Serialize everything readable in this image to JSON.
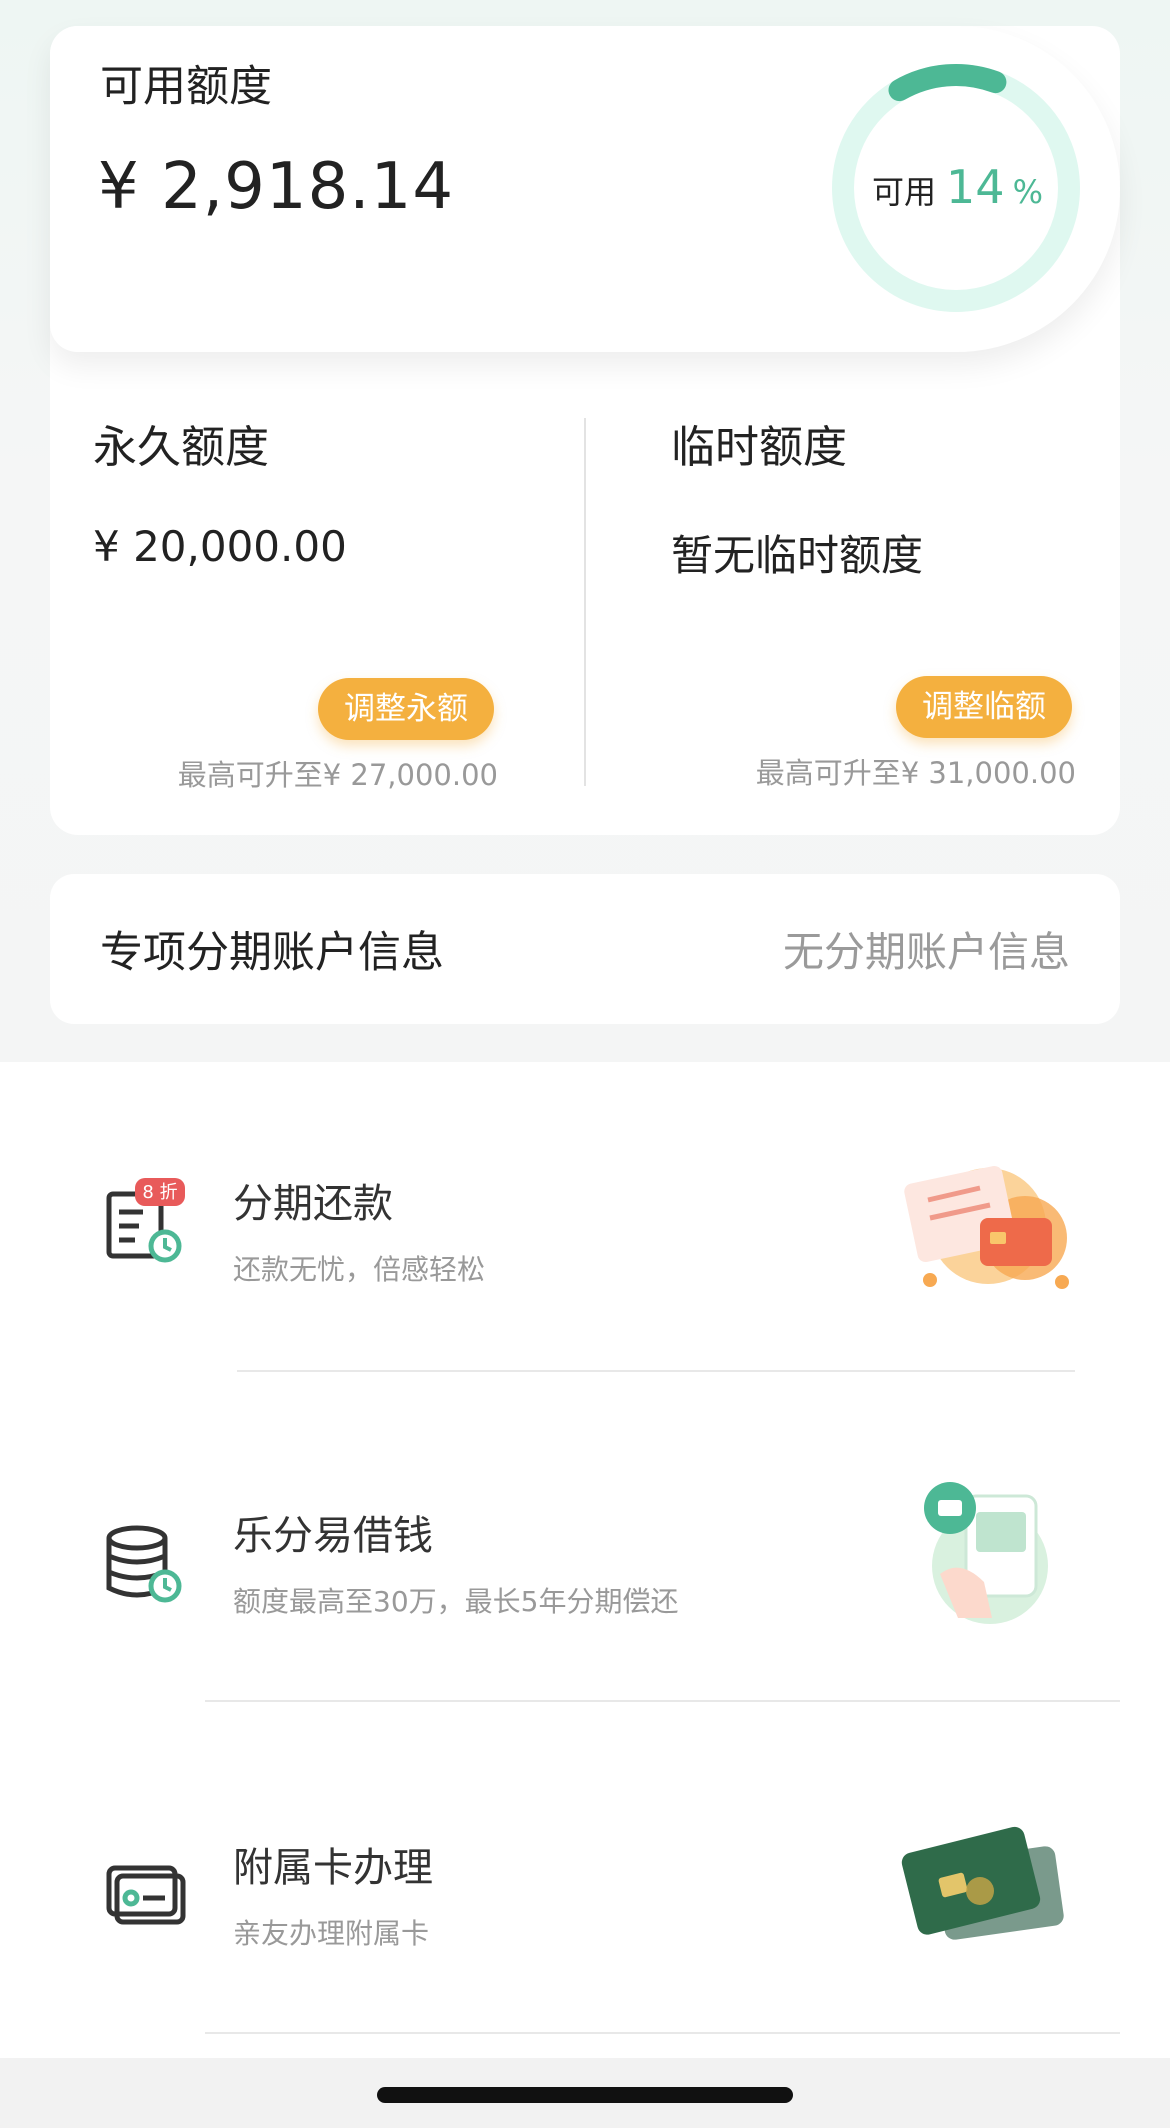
{
  "available": {
    "title": "可用额度",
    "amount": "¥ 2,918.14",
    "ring_label": "可用",
    "ring_percent_value": 14,
    "ring_percent": "14",
    "ring_unit": "%",
    "accent_color": "#4db895",
    "track_color": "#dff8f0"
  },
  "permanent": {
    "title": "永久额度",
    "value": "¥ 20,000.00",
    "button_label": "调整永额",
    "hint": "最高可升至¥ 27,000.00"
  },
  "temporary": {
    "title": "临时额度",
    "value": "暂无临时额度",
    "button_label": "调整临额",
    "hint": "最高可升至¥ 31,000.00"
  },
  "installment_account": {
    "title": "专项分期账户信息",
    "value": "无分期账户信息"
  },
  "services": [
    {
      "title": "分期还款",
      "subtitle": "还款无忧，倍感轻松",
      "icon": "bill-clock-icon",
      "badge": "8 折"
    },
    {
      "title": "乐分易借钱",
      "subtitle": "额度最高至30万，最长5年分期偿还",
      "icon": "coin-stack-clock-icon"
    },
    {
      "title": "附属卡办理",
      "subtitle": "亲友办理附属卡",
      "icon": "card-icon"
    }
  ],
  "colors": {
    "orange_button": "#f4b03f",
    "green_accent": "#4db895"
  }
}
